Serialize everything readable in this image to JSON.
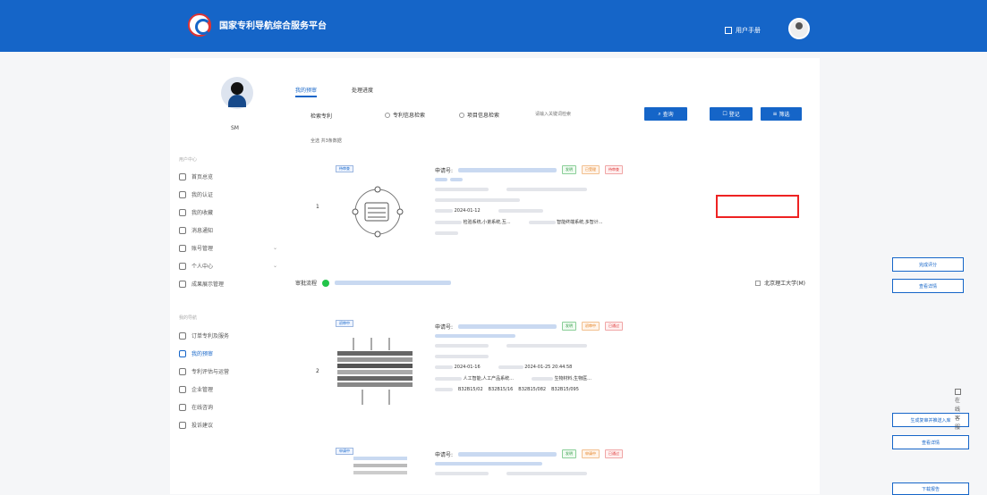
{
  "header": {
    "brand": "国家专利导航综合服务平台",
    "manual": "用户手册"
  },
  "sidebar": {
    "username": "SM",
    "section1_title": "用户中心",
    "section2_title": "我的导航",
    "items": [
      {
        "label": "首页总览",
        "icon": "home-icon"
      },
      {
        "label": "我的认证",
        "icon": "certificate-icon"
      },
      {
        "label": "我的收藏",
        "icon": "star-icon"
      },
      {
        "label": "消息通知",
        "icon": "bell-icon"
      },
      {
        "label": "账号管理",
        "icon": "account-icon"
      },
      {
        "label": "个人中心",
        "icon": "user-icon"
      },
      {
        "label": "成果展示管理",
        "icon": "document-icon"
      }
    ],
    "items2": [
      {
        "label": "订单专利及服务",
        "icon": "order-icon"
      },
      {
        "label": "我的预审",
        "icon": "review-icon",
        "active": true
      },
      {
        "label": "专利评估与运营",
        "icon": "chart-icon"
      },
      {
        "label": "企业管理",
        "icon": "building-icon"
      },
      {
        "label": "在线咨询",
        "icon": "chat-icon"
      },
      {
        "label": "投诉建议",
        "icon": "feedback-icon"
      }
    ]
  },
  "tabs": [
    "我的预审",
    "处理进度"
  ],
  "filters": {
    "label": "检索专利",
    "opt1": "专利信息检索",
    "opt2": "项目信息检索",
    "placeholder": "请输入关键词检索"
  },
  "buttons": {
    "search": "查询",
    "register": "登记",
    "filter": "筛选"
  },
  "count_line": "全选  共3条数据",
  "cards": [
    {
      "no": "1",
      "corner_tag": "待审查",
      "app_label": "申请号:",
      "badges": [
        "发明",
        "已受理",
        "待审查"
      ],
      "date": "2024-01-12",
      "line_a": "检验系统,小弟系统,互...",
      "line_b": "智能终端系统,多智计...",
      "btn1": "完成评分",
      "btn2": "查看详情"
    },
    {
      "no": "2",
      "corner_tag": "初审中",
      "app_label": "申请号:",
      "badges": [
        "发明",
        "初审中",
        "已通过"
      ],
      "date": "2024-01-16",
      "date2": "2024-01-25 20:44:58",
      "line_a": "人工智能,人工产品系统...",
      "line_b": "生物材料,生物医...",
      "ipc": [
        "B32B15/02",
        "B32B15/16",
        "B32B15/082",
        "B32B15/095"
      ],
      "btn1": "生成复审并推送入库",
      "btn2": "查看详情"
    },
    {
      "no": "3",
      "corner_tag": "申请中",
      "app_label": "申请号:",
      "badges": [
        "发明",
        "申请中",
        "已通过"
      ],
      "btn1": "下载报告"
    }
  ],
  "process": {
    "label": "审批流程",
    "univ": "北京理工大学(M)"
  },
  "float_panel": [
    "在",
    "线",
    "客",
    "服"
  ]
}
